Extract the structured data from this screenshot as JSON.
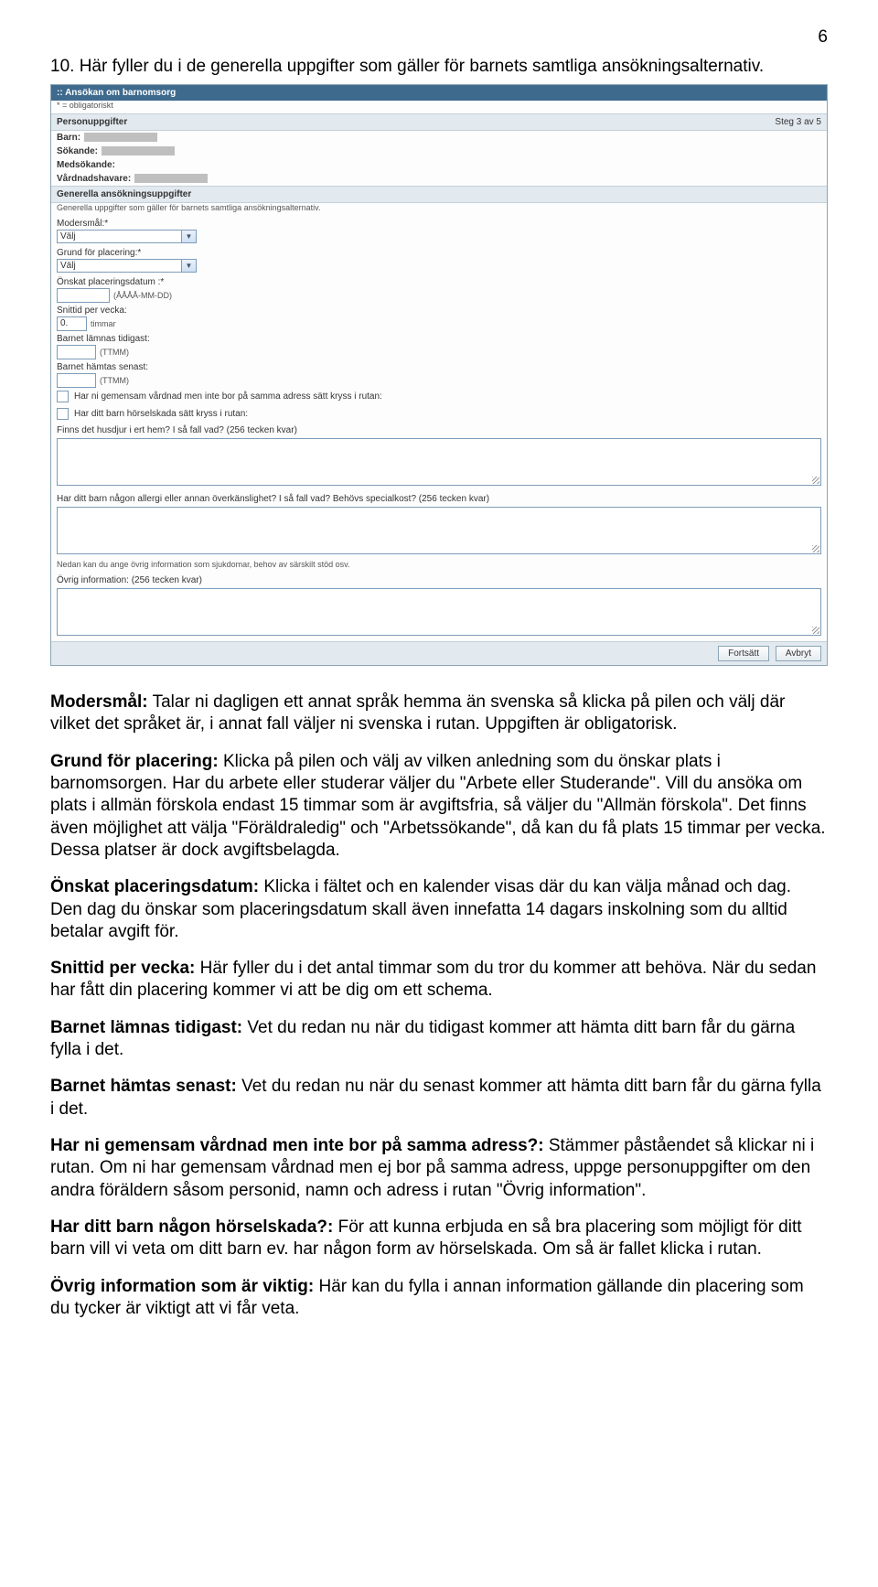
{
  "page_number": "6",
  "intro": "10. Här fyller du i de generella uppgifter som gäller för barnets samtliga ansökningsalternativ.",
  "form": {
    "title": ":: Ansökan om barnomsorg",
    "obl_note": "* = obligatoriskt",
    "personinfo_header": "Personuppgifter",
    "step": "Steg 3 av 5",
    "labels": {
      "barn": "Barn:",
      "sokande": "Sökande:",
      "medsokande": "Medsökande:",
      "vardnad": "Vårdnadshavare:"
    },
    "general_header": "Generella ansökningsuppgifter",
    "general_note": "Generella uppgifter som gäller för barnets samtliga ansökningsalternativ.",
    "fields": {
      "modersmal_label": "Modersmål:*",
      "modersmal_value": "Välj",
      "grund_label": "Grund för placering:*",
      "grund_value": "Välj",
      "onskat_label": "Önskat placeringsdatum :*",
      "onskat_hint": "(ÅÅÅÅ-MM-DD)",
      "snittid_label": "Snittid per vecka:",
      "snittid_value": "0.",
      "snittid_hint": "timmar",
      "tidigast_label": "Barnet lämnas tidigast:",
      "tidigast_hint": "(TTMM)",
      "senast_label": "Barnet hämtas senast:",
      "senast_hint": "(TTMM)",
      "cb1": "Har ni gemensam vårdnad men inte bor på samma adress sätt kryss i rutan:",
      "cb2": "Har ditt barn hörselskada sätt kryss i rutan:",
      "husdjur_label": "Finns det husdjur i ert hem? I så fall vad? (256 tecken kvar)",
      "allergi_label": "Har ditt barn någon allergi eller annan överkänslighet? I så fall vad? Behövs specialkost? (256 tecken kvar)",
      "ovrig_intro": "Nedan kan du ange övrig information som sjukdomar, behov av särskilt stöd osv.",
      "ovrig_label": "Övrig information: (256 tecken kvar)"
    },
    "buttons": {
      "fortsatt": "Fortsätt",
      "avbryt": "Avbryt"
    }
  },
  "paras": [
    {
      "bold": "Modersmål:",
      "text": " Talar ni dagligen ett annat språk hemma än svenska så klicka på pilen och välj där vilket det språket är, i annat fall väljer ni svenska i rutan. Uppgiften är obligatorisk."
    },
    {
      "bold": "Grund för placering:",
      "text": " Klicka på pilen och välj av vilken anledning som du önskar plats i barnomsorgen. Har du arbete eller studerar väljer du \"Arbete eller Studerande\". Vill du ansöka om plats i allmän förskola endast 15 timmar som är avgiftsfria, så väljer du \"Allmän förskola\". Det finns även möjlighet att välja \"Föräldraledig\" och \"Arbetssökande\", då kan du få plats 15 timmar per vecka. Dessa platser är dock avgiftsbelagda."
    },
    {
      "bold": "Önskat placeringsdatum:",
      "text": " Klicka i fältet och en kalender visas där du kan välja månad och dag. Den dag du önskar som placeringsdatum skall även innefatta 14 dagars inskolning som du alltid betalar avgift för."
    },
    {
      "bold": "Snittid per vecka:",
      "text": " Här fyller du i det antal timmar som du tror du kommer att behöva. När du sedan har fått din placering kommer vi att be dig om ett schema."
    },
    {
      "bold": "Barnet lämnas tidigast:",
      "text": " Vet du redan nu när du tidigast kommer att hämta ditt barn får du gärna fylla i det."
    },
    {
      "bold": "Barnet hämtas senast:",
      "text": " Vet du redan nu när du senast kommer att hämta ditt barn får du gärna fylla i det."
    },
    {
      "bold": "Har ni gemensam vårdnad men inte bor på samma adress?:",
      "text": " Stämmer påståendet så klickar ni i rutan. Om ni har gemensam vårdnad men ej bor på samma adress, uppge personuppgifter om den andra föräldern såsom personid, namn och adress i rutan \"Övrig information\"."
    },
    {
      "bold": "Har ditt barn någon hörselskada?:",
      "text": " För att kunna erbjuda en så bra placering som möjligt för ditt barn vill vi veta om ditt barn ev. har någon form av hörselskada. Om så är fallet klicka i rutan."
    },
    {
      "bold": "Övrig information som är viktig:",
      "text": " Här kan du fylla i annan information gällande din placering som du tycker är viktigt att vi får veta."
    }
  ]
}
